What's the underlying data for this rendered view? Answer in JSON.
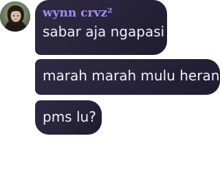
{
  "author": {
    "name": "wynn crvz²",
    "name_color": "#a58ef0",
    "avatar_icon": "profile-photo-avatar"
  },
  "messages": [
    {
      "text": "sabar aja ngapasi"
    },
    {
      "text": "marah marah mulu heran"
    },
    {
      "text": "pms lu?"
    }
  ],
  "colors": {
    "bubble_background": "#26233a",
    "message_text": "#f2f0f7",
    "page_background": "#ffffff"
  }
}
